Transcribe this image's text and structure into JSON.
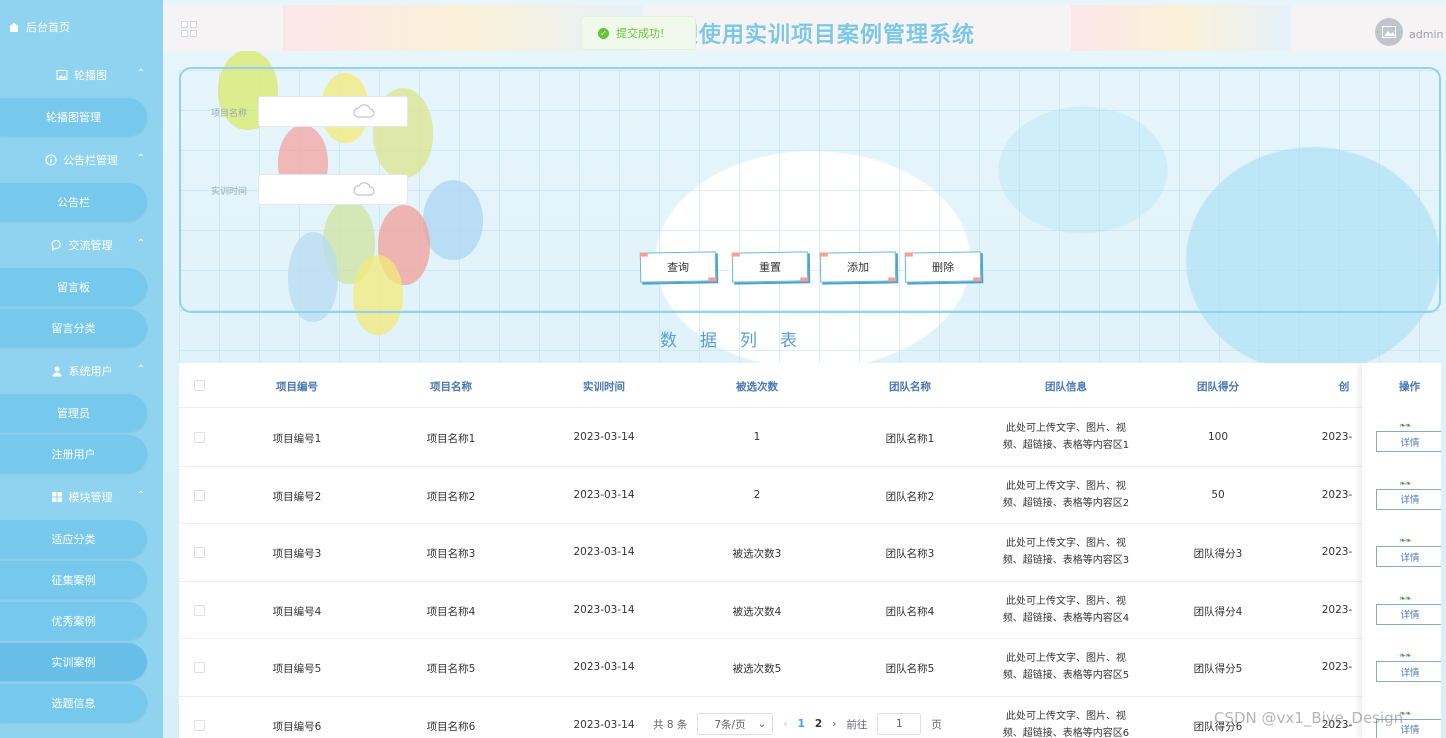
{
  "sidebar": {
    "home": "后台首页",
    "groups": [
      {
        "label": "轮播图",
        "icon": "image-icon",
        "items": [
          "轮播图管理"
        ]
      },
      {
        "label": "公告栏管理",
        "icon": "info-circle-icon",
        "items": [
          "公告栏"
        ]
      },
      {
        "label": "交流管理",
        "icon": "chat-icon",
        "items": [
          "留言板",
          "留言分类"
        ]
      },
      {
        "label": "系统用户",
        "icon": "user-icon",
        "items": [
          "管理员",
          "注册用户"
        ]
      },
      {
        "label": "模块管理",
        "icon": "grid-icon",
        "items": [
          "适应分类",
          "征集案例",
          "优秀案例",
          "实训案例",
          "选题信息"
        ]
      }
    ]
  },
  "header": {
    "title": "欢迎使用实训项目案例管理系统",
    "username": "admin",
    "toast": "提交成功!"
  },
  "search": {
    "fields": [
      {
        "label": "项目名称",
        "value": ""
      },
      {
        "label": "实训时间",
        "value": ""
      }
    ],
    "buttons": [
      "查询",
      "重置",
      "添加",
      "删除"
    ]
  },
  "list_title": "数据列表",
  "table": {
    "columns": [
      "项目编号",
      "项目名称",
      "实训时间",
      "被选次数",
      "团队名称",
      "团队信息",
      "团队得分",
      "创",
      "操作"
    ],
    "rows": [
      {
        "code": "项目编号1",
        "name": "项目名称1",
        "date": "2023-03-14",
        "count": "1",
        "team": "团队名称1",
        "info1": "此处可上传文字、图片、视",
        "info2": "频、超链接、表格等内容区1",
        "score": "100",
        "created": "2023-"
      },
      {
        "code": "项目编号2",
        "name": "项目名称2",
        "date": "2023-03-14",
        "count": "2",
        "team": "团队名称2",
        "info1": "此处可上传文字、图片、视",
        "info2": "频、超链接、表格等内容区2",
        "score": "50",
        "created": "2023-"
      },
      {
        "code": "项目编号3",
        "name": "项目名称3",
        "date": "2023-03-14",
        "count": "被选次数3",
        "team": "团队名称3",
        "info1": "此处可上传文字、图片、视",
        "info2": "频、超链接、表格等内容区3",
        "score": "团队得分3",
        "created": "2023-"
      },
      {
        "code": "项目编号4",
        "name": "项目名称4",
        "date": "2023-03-14",
        "count": "被选次数4",
        "team": "团队名称4",
        "info1": "此处可上传文字、图片、视",
        "info2": "频、超链接、表格等内容区4",
        "score": "团队得分4",
        "created": "2023-"
      },
      {
        "code": "项目编号5",
        "name": "项目名称5",
        "date": "2023-03-14",
        "count": "被选次数5",
        "team": "团队名称5",
        "info1": "此处可上传文字、图片、视",
        "info2": "频、超链接、表格等内容区5",
        "score": "团队得分5",
        "created": "2023-"
      },
      {
        "code": "项目编号6",
        "name": "项目名称6",
        "date": "2023-03-14",
        "count": "",
        "team": "",
        "info1": "此处可上传文字、图片、视",
        "info2": "频、超链接、表格等内容区6",
        "score": "团队得分6",
        "created": "2023-"
      }
    ],
    "detail_label": "详情"
  },
  "pagination": {
    "total": "共 8 条",
    "page_size": "7条/页",
    "pages": [
      "1",
      "2"
    ],
    "goto_prefix": "前往",
    "goto_value": "1",
    "goto_suffix": "页"
  },
  "watermark": "CSDN @vx1_Biye_Design",
  "colors": {
    "sidebar": "#8fd3f0",
    "accent": "#409eff",
    "success": "#67c23a"
  }
}
